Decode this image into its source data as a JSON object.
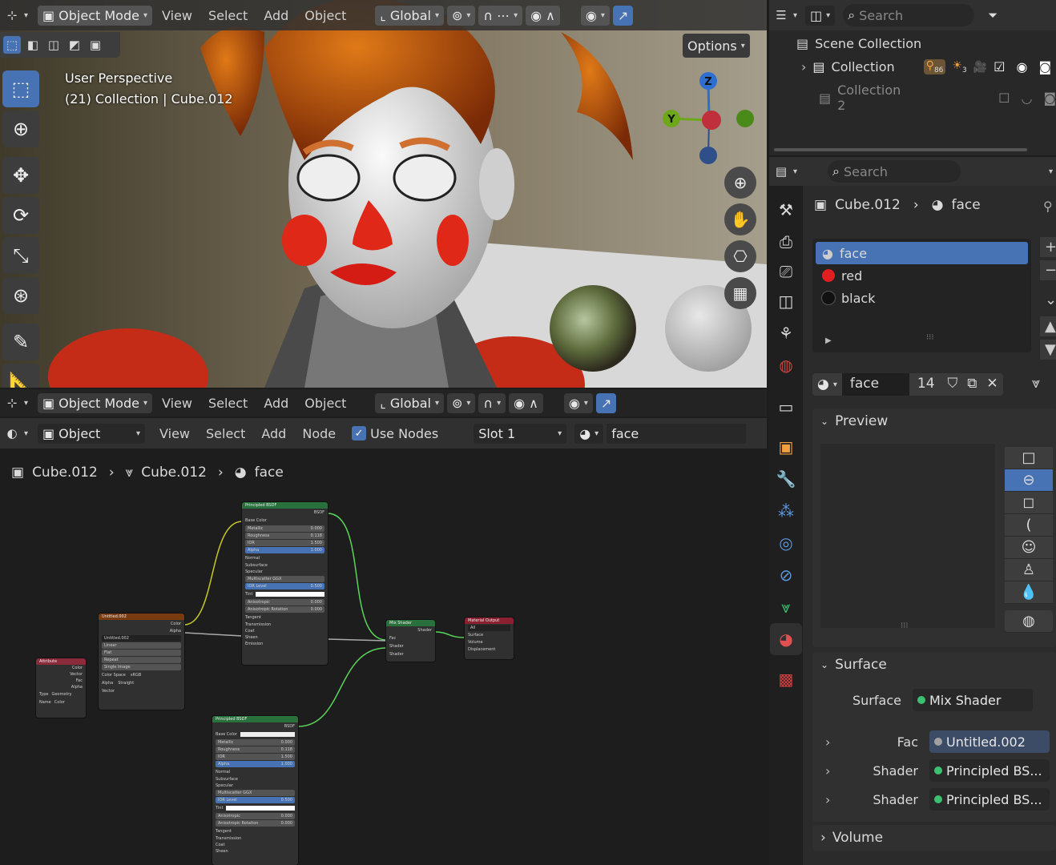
{
  "viewport": {
    "mode": "Object Mode",
    "menus": [
      "View",
      "Select",
      "Add",
      "Object"
    ],
    "orientation": "Global",
    "options": "Options",
    "overlay_title": "User Perspective",
    "overlay_sub": "(21) Collection | Cube.012",
    "axes": {
      "z": "Z",
      "y": "Y"
    }
  },
  "node_editor": {
    "mode": "Object Mode",
    "menus": [
      "View",
      "Select",
      "Add",
      "Object"
    ],
    "orientation": "Global",
    "type": "Object",
    "menus2": [
      "View",
      "Select",
      "Add",
      "Node"
    ],
    "use_nodes": "Use Nodes",
    "slot": "Slot 1",
    "material": "face",
    "breadcrumb": [
      "Cube.012",
      "Cube.012",
      "face"
    ],
    "nodes": {
      "principled1": {
        "title": "Principled BSDF",
        "out": "BSDF",
        "rows": [
          "Base Color",
          "Metallic",
          "Roughness",
          "IOR",
          "Alpha",
          "Normal",
          "Subsurface",
          "Specular",
          "Multiscatter GGX",
          "IOR Level",
          "Tint",
          "Anisotropic",
          "Anisotropic Rotation",
          "Tangent",
          "Transmission",
          "Coat",
          "Sheen",
          "Emission"
        ],
        "vals": [
          "0.000",
          "0.118",
          "1.500",
          "1.000",
          "0.500",
          "0.000",
          "0.000"
        ]
      },
      "image": {
        "title": "Untitled.002",
        "rows": [
          "Color",
          "Alpha",
          "Untitled.002",
          "Linear",
          "Flat",
          "Repeat",
          "Single Image",
          "Color Space",
          "sRGB",
          "Alpha",
          "Straight",
          "Vector"
        ]
      },
      "attribute": {
        "title": "Attribute",
        "rows": [
          "Color",
          "Vector",
          "Fac",
          "Alpha",
          "Type",
          "Geometry",
          "Name",
          "Color"
        ]
      },
      "mix": {
        "title": "Mix Shader",
        "rows": [
          "Shader",
          "Fac",
          "Shader",
          "Shader"
        ]
      },
      "output": {
        "title": "Material Output",
        "rows": [
          "All",
          "Surface",
          "Volume",
          "Displacement"
        ]
      },
      "principled2": {
        "title": "Principled BSDF",
        "out": "BSDF",
        "rows": [
          "Base Color",
          "Metallic",
          "Roughness",
          "IOR",
          "Alpha",
          "Normal",
          "Subsurface",
          "Specular",
          "Multiscatter GGX",
          "IOR Level",
          "Tint",
          "Anisotropic",
          "Anisotropic Rotation",
          "Tangent",
          "Transmission",
          "Coat",
          "Sheen"
        ],
        "vals": [
          "0.000",
          "0.118",
          "1.500",
          "1.000",
          "0.500",
          "0.000",
          "0.000"
        ]
      }
    }
  },
  "outliner": {
    "search": "Search",
    "scene": "Scene Collection",
    "items": [
      {
        "name": "Collection",
        "c1": "86",
        "c2": "3"
      },
      {
        "name": "Collection 2"
      }
    ]
  },
  "properties": {
    "search": "Search",
    "breadcrumb": [
      "Cube.012",
      "face"
    ],
    "slots": [
      "face",
      "red",
      "black"
    ],
    "material_name": "face",
    "users": "14",
    "preview": "Preview",
    "surface_panel": "Surface",
    "surface_label": "Surface",
    "surface_value": "Mix Shader",
    "inputs": [
      {
        "label": "Fac",
        "value": "Untitled.002"
      },
      {
        "label": "Shader",
        "value": "Principled BS..."
      },
      {
        "label": "Shader",
        "value": "Principled BS..."
      }
    ],
    "volume": "Volume"
  },
  "colors": {
    "accent": "#4772b3",
    "header": "#303030",
    "panel": "#2b2b2b"
  }
}
